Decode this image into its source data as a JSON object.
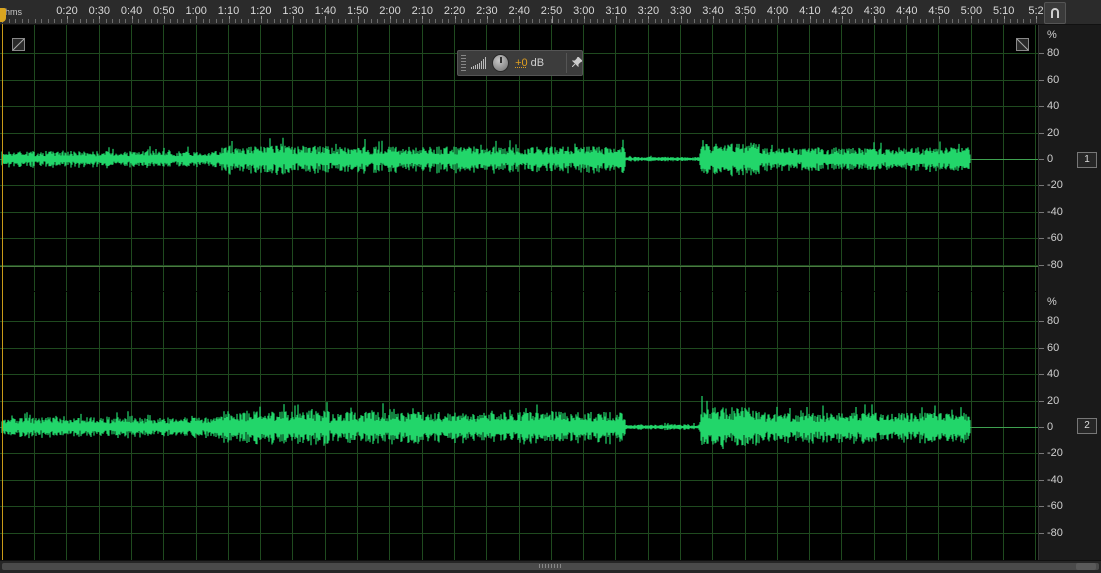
{
  "ruler": {
    "unit_label": "hms",
    "ticks": [
      "0:20",
      "0:30",
      "0:40",
      "0:50",
      "1:00",
      "1:10",
      "1:20",
      "1:30",
      "1:40",
      "1:50",
      "2:00",
      "2:10",
      "2:20",
      "2:30",
      "2:40",
      "2:50",
      "3:00",
      "3:10",
      "3:20",
      "3:30",
      "3:40",
      "3:50",
      "4:00",
      "4:10",
      "4:20",
      "4:30",
      "4:40",
      "4:50",
      "5:00",
      "5:10",
      "5:2"
    ],
    "snap_button_icon": "magnet-icon"
  },
  "hud": {
    "volume_value": "+0",
    "volume_unit": "dB",
    "knob_icon": "volume-knob-icon",
    "pin_icon": "pin-icon"
  },
  "amplitude_scale": {
    "unit": "%",
    "labels": [
      "80",
      "60",
      "40",
      "20",
      "0",
      "-20",
      "-40",
      "-60",
      "-80"
    ]
  },
  "channels": [
    {
      "badge": "1"
    },
    {
      "badge": "2"
    }
  ],
  "colors": {
    "waveform": "#22d66a",
    "grid": "#1f4a1f",
    "background": "#000000",
    "playhead": "#d9a520"
  }
}
